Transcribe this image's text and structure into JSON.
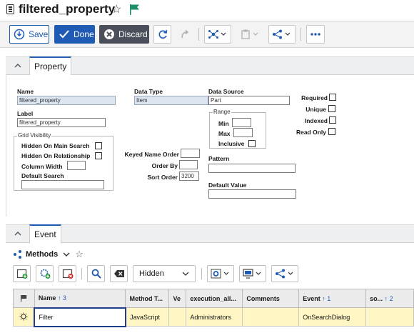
{
  "title": {
    "text": "filtered_property",
    "star_icon": "star-outline-icon",
    "flag_icon": "flag-icon",
    "flag_color": "#1a8f6a"
  },
  "toolbar": {
    "save_label": "Save",
    "done_label": "Done",
    "discard_label": "Discard",
    "accent": "#1f5bb5"
  },
  "property_section": {
    "tab_label": "Property",
    "name": {
      "label": "Name",
      "value": "filtered_property"
    },
    "label_field": {
      "label": "Label",
      "value": "filtered_property"
    },
    "grid_visibility": {
      "title": "Grid Visibility",
      "hidden_main_search": "Hidden On Main Search",
      "hidden_relationship": "Hidden On Relationship",
      "column_width": "Column Width",
      "default_search": "Default Search"
    },
    "data_type": {
      "label": "Data Type",
      "value": "Item"
    },
    "keyed_name_order": "Keyed Name Order",
    "order_by": "Order By",
    "sort_order": {
      "label": "Sort Order",
      "value": "3200"
    },
    "data_source": {
      "label": "Data Source",
      "value": "Part"
    },
    "range": {
      "title": "Range",
      "min": "Min",
      "max": "Max",
      "inclusive": "Inclusive"
    },
    "pattern": "Pattern",
    "default_value": "Default Value",
    "required": "Required",
    "unique": "Unique",
    "indexed": "Indexed",
    "read_only": "Read Only"
  },
  "event_section": {
    "tab_label": "Event",
    "methods_label": "Methods",
    "filter_select": "Hidden",
    "columns": [
      {
        "label": "Name",
        "sort": "↑",
        "order": "3"
      },
      {
        "label": "Method T...",
        "sort": "",
        "order": ""
      },
      {
        "label": "Ve",
        "sort": "",
        "order": ""
      },
      {
        "label": "execution_all...",
        "sort": "",
        "order": ""
      },
      {
        "label": "Comments",
        "sort": "",
        "order": ""
      },
      {
        "label": "Event",
        "sort": "↑",
        "order": "1"
      },
      {
        "label": "so...",
        "sort": "↑",
        "order": "2"
      }
    ],
    "rows": [
      {
        "name": "Filter",
        "method_type": "JavaScript",
        "version": "",
        "execution": "Administrators",
        "comments": "",
        "event": "OnSearchDialog",
        "sort": ""
      }
    ]
  }
}
